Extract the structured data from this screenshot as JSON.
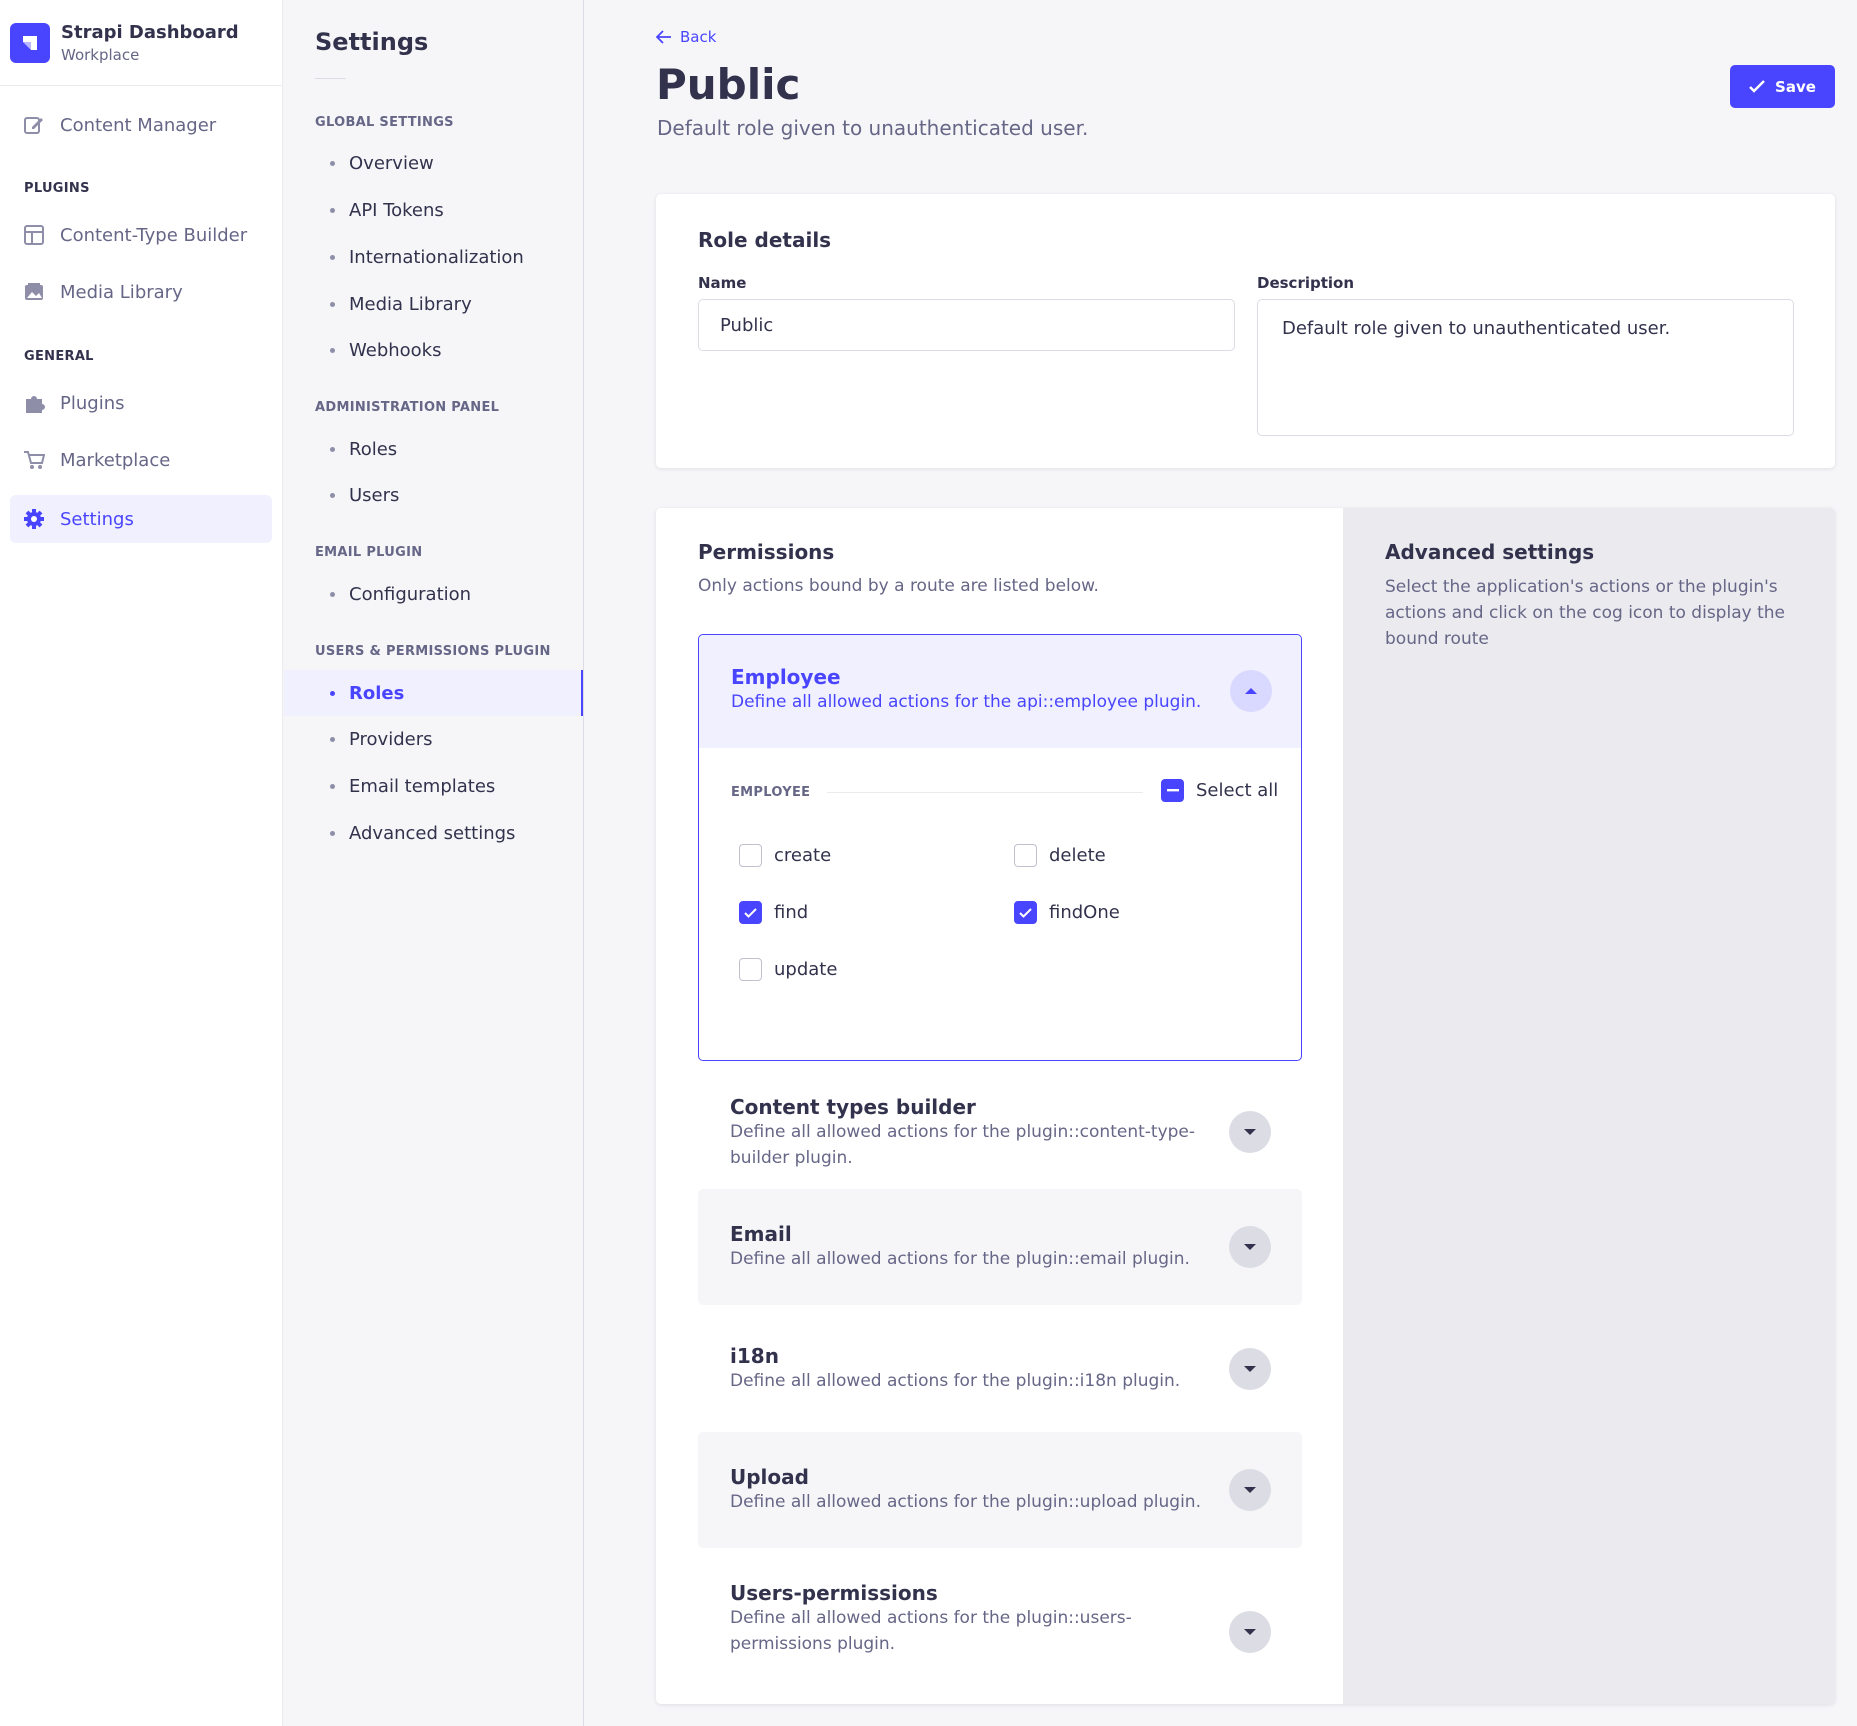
{
  "brand": {
    "title": "Strapi Dashboard",
    "subtitle": "Workplace"
  },
  "mainnav": {
    "content_manager": "Content Manager",
    "plugins_section": "PLUGINS",
    "content_type_builder": "Content-Type Builder",
    "media_library": "Media Library",
    "general_section": "GENERAL",
    "plugins": "Plugins",
    "marketplace": "Marketplace",
    "settings": "Settings"
  },
  "subnav": {
    "title": "Settings",
    "global_section": "GLOBAL SETTINGS",
    "global_items": [
      "Overview",
      "API Tokens",
      "Internationalization",
      "Media Library",
      "Webhooks"
    ],
    "admin_section": "ADMINISTRATION PANEL",
    "admin_items": [
      "Roles",
      "Users"
    ],
    "email_section": "EMAIL PLUGIN",
    "email_items": [
      "Configuration"
    ],
    "users_section": "USERS & PERMISSIONS PLUGIN",
    "users_items": [
      "Roles",
      "Providers",
      "Email templates",
      "Advanced settings"
    ],
    "active_item": "Roles"
  },
  "header": {
    "back_label": "Back",
    "title": "Public",
    "subtitle": "Default role given to unauthenticated user.",
    "save_label": "Save"
  },
  "role_details": {
    "heading": "Role details",
    "name_label": "Name",
    "name_value": "Public",
    "description_label": "Description",
    "description_value": "Default role given to unauthenticated user."
  },
  "permissions": {
    "heading": "Permissions",
    "subtitle": "Only actions bound by a route are listed below.",
    "employee": {
      "name": "Employee",
      "description": "Define all allowed actions for the api::employee plugin.",
      "group_label": "EMPLOYEE",
      "select_all_label": "Select all",
      "actions": [
        {
          "label": "create",
          "checked": false
        },
        {
          "label": "delete",
          "checked": false
        },
        {
          "label": "find",
          "checked": true
        },
        {
          "label": "findOne",
          "checked": true
        },
        {
          "label": "update",
          "checked": false
        }
      ]
    },
    "plugins": [
      {
        "name": "Content types builder",
        "description": "Define all allowed actions for the plugin::content-type-builder plugin."
      },
      {
        "name": "Email",
        "description": "Define all allowed actions for the plugin::email plugin."
      },
      {
        "name": "i18n",
        "description": "Define all allowed actions for the plugin::i18n plugin."
      },
      {
        "name": "Upload",
        "description": "Define all allowed actions for the plugin::upload plugin."
      },
      {
        "name": "Users-permissions",
        "description": "Define all allowed actions for the plugin::users-permissions plugin."
      }
    ]
  },
  "advanced": {
    "heading": "Advanced settings",
    "text": "Select the application's actions or the plugin's actions and click on the cog icon to display the bound route"
  },
  "colors": {
    "primary": "#4945ff",
    "primary_light": "#f0f0ff",
    "text": "#32324d",
    "muted": "#666687"
  }
}
